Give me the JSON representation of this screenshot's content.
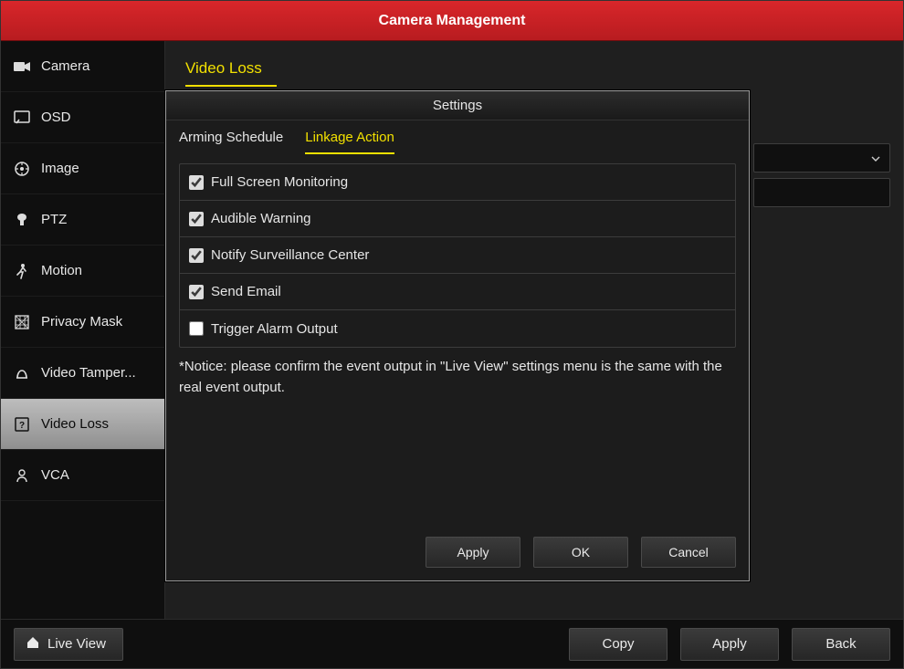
{
  "title": "Camera Management",
  "sidebar": {
    "items": [
      {
        "label": "Camera",
        "icon": "camera-icon"
      },
      {
        "label": "OSD",
        "icon": "osd-icon"
      },
      {
        "label": "Image",
        "icon": "image-icon"
      },
      {
        "label": "PTZ",
        "icon": "ptz-icon"
      },
      {
        "label": "Motion",
        "icon": "motion-icon"
      },
      {
        "label": "Privacy Mask",
        "icon": "mask-icon"
      },
      {
        "label": "Video Tamper...",
        "icon": "tamper-icon"
      },
      {
        "label": "Video Loss",
        "icon": "video-loss-icon",
        "active": true
      },
      {
        "label": "VCA",
        "icon": "vca-icon"
      }
    ]
  },
  "section": {
    "title": "Video Loss"
  },
  "dialog": {
    "title": "Settings",
    "tabs": [
      {
        "label": "Arming Schedule"
      },
      {
        "label": "Linkage Action",
        "active": true
      }
    ],
    "options": [
      {
        "label": "Full Screen Monitoring",
        "checked": true
      },
      {
        "label": "Audible Warning",
        "checked": true
      },
      {
        "label": "Notify Surveillance Center",
        "checked": true
      },
      {
        "label": "Send Email",
        "checked": true
      },
      {
        "label": "Trigger Alarm Output",
        "checked": false
      }
    ],
    "notice": "*Notice: please confirm the event output in \"Live View\" settings menu is the same with the real event output.",
    "buttons": {
      "apply": "Apply",
      "ok": "OK",
      "cancel": "Cancel"
    }
  },
  "footer": {
    "live": "Live View",
    "copy": "Copy",
    "apply": "Apply",
    "back": "Back"
  }
}
